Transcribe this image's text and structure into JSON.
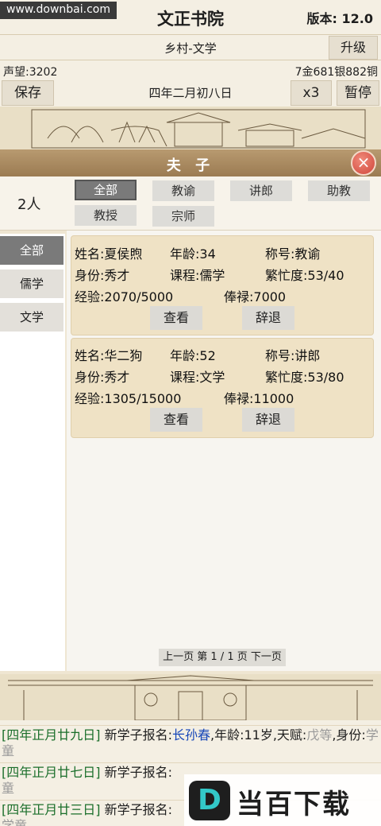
{
  "header": {
    "watermark": "www.downbai.com",
    "title": "文正书院",
    "version": "版本: 12.0",
    "school_type": "乡村-文学",
    "upgrade_label": "升级",
    "reputation": "声望:3202",
    "money": "7金681银882铜",
    "save_label": "保存",
    "date": "四年二月初八日",
    "speed_label": "x3",
    "pause_label": "暂停"
  },
  "panel": {
    "title": "夫 子",
    "close_icon": "×",
    "count": "2人",
    "filters": [
      "全部",
      "教谕",
      "讲郎",
      "助教",
      "教授",
      "宗师"
    ],
    "active_filter": "全部",
    "sidebar": [
      "全部",
      "儒学",
      "文学"
    ],
    "active_sidebar": "全部",
    "teachers": [
      {
        "name": "姓名:夏侯煦",
        "age": "年龄:34",
        "rank": "称号:教谕",
        "status": "身份:秀才",
        "course": "课程:儒学",
        "busy": "繁忙度:53/40",
        "exp": "经验:2070/5000",
        "salary": "俸禄:7000",
        "view_label": "查看",
        "dismiss_label": "辞退"
      },
      {
        "name": "姓名:华二狗",
        "age": "年龄:52",
        "rank": "称号:讲郎",
        "status": "身份:秀才",
        "course": "课程:文学",
        "busy": "繁忙度:53/80",
        "exp": "经验:1305/15000",
        "salary": "俸禄:11000",
        "view_label": "查看",
        "dismiss_label": "辞退"
      }
    ],
    "pager": "上一页 第 1 / 1 页 下一页"
  },
  "logs": [
    {
      "date": "[四年正月廿九日]",
      "text": " 新学子报名:",
      "name": "长孙春",
      "rest": ",年龄:11岁,天赋:",
      "talent": "戊等",
      "tail": ",身份:",
      "status": "学童"
    },
    {
      "date": "[四年正月廿七日]",
      "text": " 新学子报名:",
      "name": "",
      "rest": "",
      "talent": "",
      "tail": "",
      "status": ""
    },
    {
      "date": "[四年正月廿三日]",
      "text": " 新学子报名:",
      "name": "",
      "rest": "",
      "talent": "",
      "tail": "",
      "status": ""
    }
  ],
  "log_line2_tail": "童",
  "log_line3_tail": "学童",
  "brand": {
    "logo": "D",
    "text": "当百下载"
  }
}
